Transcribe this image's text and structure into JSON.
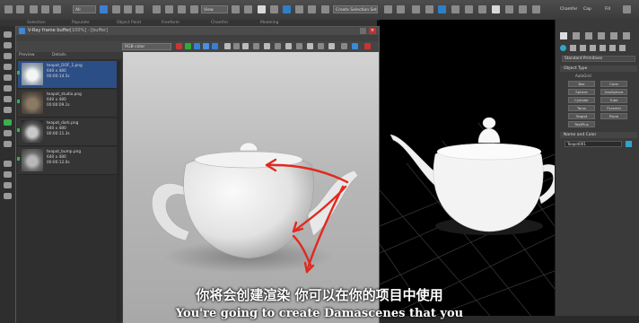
{
  "toolbar": {
    "dropdown1": "All",
    "dropdown2": "View",
    "dropdown3": "Create Selection Set",
    "right_items": [
      "Chamfer",
      "Cap",
      "Fill"
    ]
  },
  "submenu": [
    "Selection",
    "Populate",
    "Object Paint",
    "Freeform",
    "Chamfer",
    "Modeling"
  ],
  "vfb": {
    "title": "V-Ray frame buffer",
    "title_suffix": "[100%] - [buffer]",
    "tools_dropdown": "RGB color",
    "history_header": [
      "Preview",
      "Details"
    ],
    "history": [
      {
        "name": "teapot_DOF_1.png",
        "res": "640 x 480",
        "time": "00:00:14.5s",
        "selected": true
      },
      {
        "name": "teapot_studio.png",
        "res": "640 x 480",
        "time": "00:00:09.1s",
        "selected": false
      },
      {
        "name": "teapot_dark.png",
        "res": "640 x 480",
        "time": "00:00:11.3s",
        "selected": false
      },
      {
        "name": "teapot_bump.png",
        "res": "640 x 480",
        "time": "00:00:12.0s",
        "selected": false
      }
    ]
  },
  "command_panel": {
    "title": "Standard Primitives",
    "object_type_label": "Object Type",
    "autogrid": "AutoGrid",
    "buttons": [
      "Box",
      "Cone",
      "Sphere",
      "GeoSphere",
      "Cylinder",
      "Tube",
      "Torus",
      "Pyramid",
      "Teapot",
      "Plane",
      "TextPlus"
    ],
    "name_color_label": "Name and Color",
    "name_value": "Teapot001",
    "accent": "#2fa6c9"
  },
  "subtitles": {
    "cn": "你将会创建渲染 你可以在你的项目中使用",
    "en": "You're going to create Damascenes that you"
  },
  "colors": {
    "arrow": "#e02a1f",
    "selected_row": "#2c4e86"
  }
}
